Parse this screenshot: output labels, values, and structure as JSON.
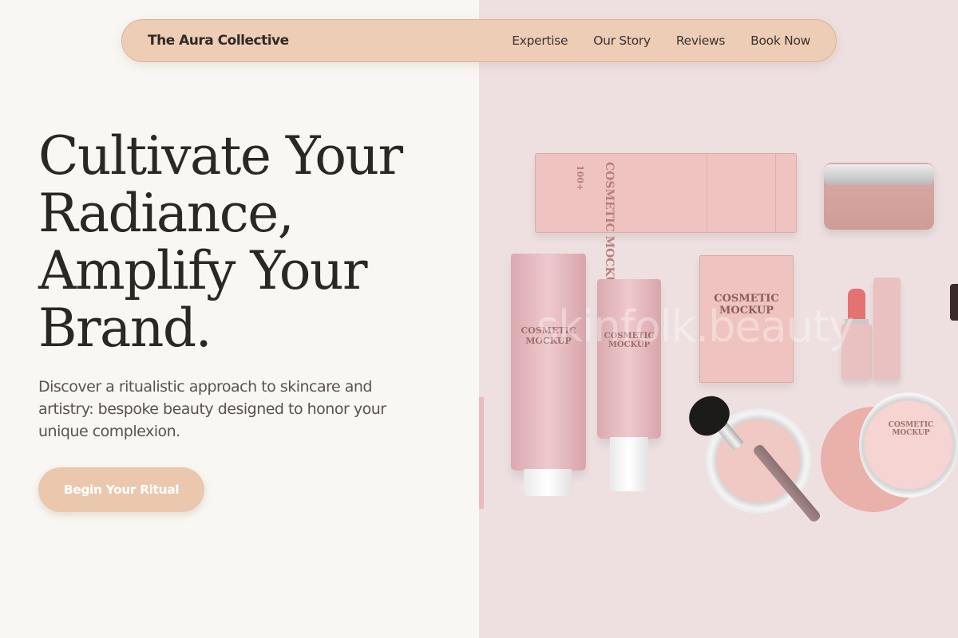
{
  "nav": {
    "brand": "The Aura Collective",
    "links": [
      {
        "label": "Expertise"
      },
      {
        "label": "Our Story"
      },
      {
        "label": "Reviews"
      },
      {
        "label": "Book Now"
      }
    ]
  },
  "hero": {
    "headline_lines": [
      "Cultivate Your",
      "Radiance,",
      "Amplify Your",
      "Brand."
    ],
    "subtext": "Discover a ritualistic approach to skincare and artistry: bespoke beauty designed to honor your unique complexion.",
    "cta_label": "Begin Your Ritual"
  },
  "product_image": {
    "watermark": "skinfolk.beauty",
    "box_label": "COSMETIC MOCKUP",
    "box_small": "100+",
    "tube_label": "COSMETIC MOCKUP",
    "sachet_label": "COSMETIC MOCKUP",
    "compact_label": "COSMETIC MOCKUP"
  },
  "colors": {
    "nav_bg": "#edcdb5",
    "cta_bg": "#ebc7ae",
    "left_bg": "#f9f7f3",
    "right_bg": "#eee0e0"
  }
}
